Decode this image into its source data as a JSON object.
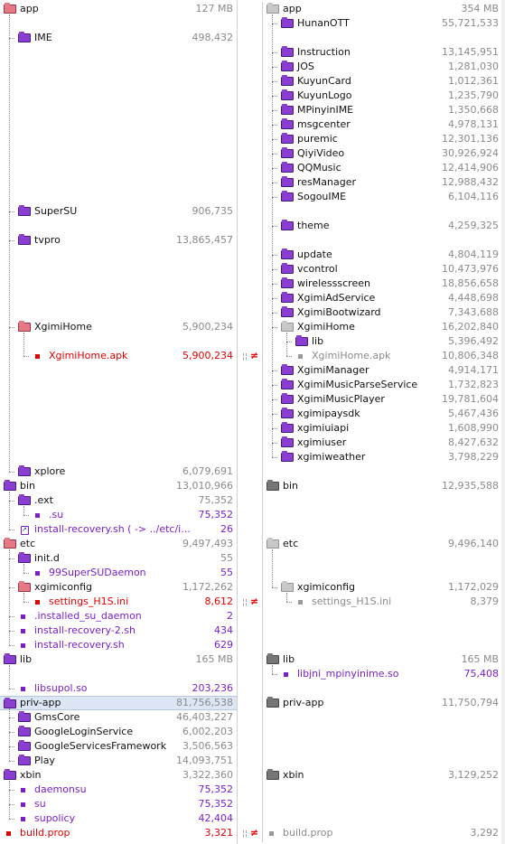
{
  "left": {
    "rows": [
      {
        "row": 0,
        "level": 0,
        "kind": "folder",
        "icon": "folder-open-red",
        "name": "app",
        "name_color": "black",
        "size": "127 MB",
        "size_color": "grey"
      },
      {
        "row": 2,
        "level": 1,
        "kind": "folder",
        "icon": "folder-purple",
        "name": "IME",
        "name_color": "black",
        "size": "498,432",
        "size_color": "grey"
      },
      {
        "row": 14,
        "level": 1,
        "kind": "folder",
        "icon": "folder-purple",
        "name": "SuperSU",
        "name_color": "black",
        "size": "906,735",
        "size_color": "grey"
      },
      {
        "row": 16,
        "level": 1,
        "kind": "folder",
        "icon": "folder-purple",
        "name": "tvpro",
        "name_color": "black",
        "size": "13,865,457",
        "size_color": "grey"
      },
      {
        "row": 22,
        "level": 1,
        "kind": "folder",
        "icon": "folder-open-red",
        "name": "XgimiHome",
        "name_color": "black",
        "size": "5,900,234",
        "size_color": "grey"
      },
      {
        "row": 24,
        "level": 2,
        "kind": "file",
        "icon": "file-red",
        "name": "XgimiHome.apk",
        "name_color": "red",
        "size": "5,900,234",
        "size_color": "red"
      },
      {
        "row": 32,
        "level": 1,
        "kind": "folder",
        "icon": "folder-purple",
        "name": "xplore",
        "name_color": "black",
        "size": "6,079,691",
        "size_color": "grey"
      },
      {
        "row": 33,
        "level": 0,
        "kind": "folder",
        "icon": "folder-purple",
        "name": "bin",
        "name_color": "black",
        "size": "13,010,966",
        "size_color": "grey"
      },
      {
        "row": 34,
        "level": 1,
        "kind": "folder",
        "icon": "folder-purple",
        "name": ".ext",
        "name_color": "black",
        "size": "75,352",
        "size_color": "grey"
      },
      {
        "row": 35,
        "level": 2,
        "kind": "file",
        "icon": "file-purple",
        "name": ".su",
        "name_color": "purple",
        "size": "75,352",
        "size_color": "purple"
      },
      {
        "row": 36,
        "level": 1,
        "kind": "link",
        "icon": "link-icon",
        "name": "install-recovery.sh ( -> ../etc/i...",
        "name_color": "purple",
        "size": "26",
        "size_color": "purple"
      },
      {
        "row": 37,
        "level": 0,
        "kind": "folder",
        "icon": "folder-open-red",
        "name": "etc",
        "name_color": "black",
        "size": "9,497,493",
        "size_color": "grey"
      },
      {
        "row": 38,
        "level": 1,
        "kind": "folder",
        "icon": "folder-purple",
        "name": "init.d",
        "name_color": "black",
        "size": "55",
        "size_color": "grey"
      },
      {
        "row": 39,
        "level": 2,
        "kind": "file",
        "icon": "file-purple",
        "name": "99SuperSUDaemon",
        "name_color": "purple",
        "size": "55",
        "size_color": "purple"
      },
      {
        "row": 40,
        "level": 1,
        "kind": "folder",
        "icon": "folder-open-red",
        "name": "xgimiconfig",
        "name_color": "black",
        "size": "1,172,262",
        "size_color": "grey"
      },
      {
        "row": 41,
        "level": 2,
        "kind": "file",
        "icon": "file-red",
        "name": "settings_H1S.ini",
        "name_color": "red",
        "size": "8,612",
        "size_color": "red"
      },
      {
        "row": 42,
        "level": 1,
        "kind": "file",
        "icon": "file-purple",
        "name": ".installed_su_daemon",
        "name_color": "purple",
        "size": "2",
        "size_color": "purple"
      },
      {
        "row": 43,
        "level": 1,
        "kind": "file",
        "icon": "file-purple",
        "name": "install-recovery-2.sh",
        "name_color": "purple",
        "size": "434",
        "size_color": "purple"
      },
      {
        "row": 44,
        "level": 1,
        "kind": "file",
        "icon": "file-purple",
        "name": "install-recovery.sh",
        "name_color": "purple",
        "size": "629",
        "size_color": "purple"
      },
      {
        "row": 45,
        "level": 0,
        "kind": "folder",
        "icon": "folder-purple",
        "name": "lib",
        "name_color": "black",
        "size": "165 MB",
        "size_color": "grey"
      },
      {
        "row": 47,
        "level": 1,
        "kind": "file",
        "icon": "file-purple",
        "name": "libsupol.so",
        "name_color": "purple",
        "size": "203,236",
        "size_color": "purple"
      },
      {
        "row": 48,
        "level": 0,
        "kind": "folder",
        "icon": "folder-purple",
        "name": "priv-app",
        "name_color": "black",
        "size": "81,756,538",
        "size_color": "grey",
        "selected": true
      },
      {
        "row": 49,
        "level": 1,
        "kind": "folder",
        "icon": "folder-purple",
        "name": "GmsCore",
        "name_color": "black",
        "size": "46,403,227",
        "size_color": "grey"
      },
      {
        "row": 50,
        "level": 1,
        "kind": "folder",
        "icon": "folder-purple",
        "name": "GoogleLoginService",
        "name_color": "black",
        "size": "6,002,203",
        "size_color": "grey"
      },
      {
        "row": 51,
        "level": 1,
        "kind": "folder",
        "icon": "folder-purple",
        "name": "GoogleServicesFramework",
        "name_color": "black",
        "size": "3,506,563",
        "size_color": "grey"
      },
      {
        "row": 52,
        "level": 1,
        "kind": "folder",
        "icon": "folder-purple",
        "name": "Play",
        "name_color": "black",
        "size": "14,093,751",
        "size_color": "grey"
      },
      {
        "row": 53,
        "level": 0,
        "kind": "folder",
        "icon": "folder-purple",
        "name": "xbin",
        "name_color": "black",
        "size": "3,322,360",
        "size_color": "grey"
      },
      {
        "row": 54,
        "level": 1,
        "kind": "file",
        "icon": "file-purple",
        "name": "daemonsu",
        "name_color": "purple",
        "size": "75,352",
        "size_color": "purple"
      },
      {
        "row": 55,
        "level": 1,
        "kind": "file",
        "icon": "file-purple",
        "name": "su",
        "name_color": "purple",
        "size": "75,352",
        "size_color": "purple"
      },
      {
        "row": 56,
        "level": 1,
        "kind": "file",
        "icon": "file-purple",
        "name": "supolicy",
        "name_color": "purple",
        "size": "42,404",
        "size_color": "purple"
      },
      {
        "row": 57,
        "level": 0,
        "kind": "file",
        "icon": "file-red",
        "name": "build.prop",
        "name_color": "red",
        "size": "3,321",
        "size_color": "red",
        "root_file": true
      }
    ]
  },
  "right": {
    "rows": [
      {
        "row": 0,
        "level": 0,
        "kind": "folder",
        "icon": "folder-open-grey",
        "name": "app",
        "name_color": "black",
        "size": "354 MB",
        "size_color": "grey"
      },
      {
        "row": 1,
        "level": 1,
        "kind": "folder",
        "icon": "folder-purple",
        "name": "HunanOTT",
        "name_color": "black",
        "size": "55,721,533",
        "size_color": "grey"
      },
      {
        "row": 3,
        "level": 1,
        "kind": "folder",
        "icon": "folder-purple",
        "name": "Instruction",
        "name_color": "black",
        "size": "13,145,951",
        "size_color": "grey"
      },
      {
        "row": 4,
        "level": 1,
        "kind": "folder",
        "icon": "folder-purple",
        "name": "JOS",
        "name_color": "black",
        "size": "1,281,030",
        "size_color": "grey"
      },
      {
        "row": 5,
        "level": 1,
        "kind": "folder",
        "icon": "folder-purple",
        "name": "KuyunCard",
        "name_color": "black",
        "size": "1,012,361",
        "size_color": "grey"
      },
      {
        "row": 6,
        "level": 1,
        "kind": "folder",
        "icon": "folder-purple",
        "name": "KuyunLogo",
        "name_color": "black",
        "size": "1,235,790",
        "size_color": "grey"
      },
      {
        "row": 7,
        "level": 1,
        "kind": "folder",
        "icon": "folder-purple",
        "name": "MPinyinIME",
        "name_color": "black",
        "size": "1,350,668",
        "size_color": "grey"
      },
      {
        "row": 8,
        "level": 1,
        "kind": "folder",
        "icon": "folder-purple",
        "name": "msgcenter",
        "name_color": "black",
        "size": "4,978,131",
        "size_color": "grey"
      },
      {
        "row": 9,
        "level": 1,
        "kind": "folder",
        "icon": "folder-purple",
        "name": "puremic",
        "name_color": "black",
        "size": "12,301,136",
        "size_color": "grey"
      },
      {
        "row": 10,
        "level": 1,
        "kind": "folder",
        "icon": "folder-purple",
        "name": "QiyiVideo",
        "name_color": "black",
        "size": "30,926,924",
        "size_color": "grey"
      },
      {
        "row": 11,
        "level": 1,
        "kind": "folder",
        "icon": "folder-purple",
        "name": "QQMusic",
        "name_color": "black",
        "size": "12,414,906",
        "size_color": "grey"
      },
      {
        "row": 12,
        "level": 1,
        "kind": "folder",
        "icon": "folder-purple",
        "name": "resManager",
        "name_color": "black",
        "size": "12,988,432",
        "size_color": "grey"
      },
      {
        "row": 13,
        "level": 1,
        "kind": "folder",
        "icon": "folder-purple",
        "name": "SogouIME",
        "name_color": "black",
        "size": "6,104,116",
        "size_color": "grey"
      },
      {
        "row": 15,
        "level": 1,
        "kind": "folder",
        "icon": "folder-purple",
        "name": "theme",
        "name_color": "black",
        "size": "4,259,325",
        "size_color": "grey"
      },
      {
        "row": 17,
        "level": 1,
        "kind": "folder",
        "icon": "folder-purple",
        "name": "update",
        "name_color": "black",
        "size": "4,804,119",
        "size_color": "grey"
      },
      {
        "row": 18,
        "level": 1,
        "kind": "folder",
        "icon": "folder-purple",
        "name": "vcontrol",
        "name_color": "black",
        "size": "10,473,976",
        "size_color": "grey"
      },
      {
        "row": 19,
        "level": 1,
        "kind": "folder",
        "icon": "folder-purple",
        "name": "wirelessscreen",
        "name_color": "black",
        "size": "18,856,658",
        "size_color": "grey"
      },
      {
        "row": 20,
        "level": 1,
        "kind": "folder",
        "icon": "folder-purple",
        "name": "XgimiAdService",
        "name_color": "black",
        "size": "4,448,698",
        "size_color": "grey"
      },
      {
        "row": 21,
        "level": 1,
        "kind": "folder",
        "icon": "folder-purple",
        "name": "XgimiBootwizard",
        "name_color": "black",
        "size": "7,343,688",
        "size_color": "grey"
      },
      {
        "row": 22,
        "level": 1,
        "kind": "folder",
        "icon": "folder-open-grey",
        "name": "XgimiHome",
        "name_color": "black",
        "size": "16,202,840",
        "size_color": "grey"
      },
      {
        "row": 23,
        "level": 2,
        "kind": "folder",
        "icon": "folder-purple",
        "name": "lib",
        "name_color": "black",
        "size": "5,396,492",
        "size_color": "grey"
      },
      {
        "row": 24,
        "level": 2,
        "kind": "file",
        "icon": "file-grey",
        "name": "XgimiHome.apk",
        "name_color": "grey",
        "size": "10,806,348",
        "size_color": "grey"
      },
      {
        "row": 25,
        "level": 1,
        "kind": "folder",
        "icon": "folder-purple",
        "name": "XgimiManager",
        "name_color": "black",
        "size": "4,914,171",
        "size_color": "grey"
      },
      {
        "row": 26,
        "level": 1,
        "kind": "folder",
        "icon": "folder-purple",
        "name": "XgimiMusicParseService",
        "name_color": "black",
        "size": "1,732,823",
        "size_color": "grey"
      },
      {
        "row": 27,
        "level": 1,
        "kind": "folder",
        "icon": "folder-purple",
        "name": "XgimiMusicPlayer",
        "name_color": "black",
        "size": "19,781,604",
        "size_color": "grey"
      },
      {
        "row": 28,
        "level": 1,
        "kind": "folder",
        "icon": "folder-purple",
        "name": "xgimipaysdk",
        "name_color": "black",
        "size": "5,467,436",
        "size_color": "grey"
      },
      {
        "row": 29,
        "level": 1,
        "kind": "folder",
        "icon": "folder-purple",
        "name": "xgimiuiapi",
        "name_color": "black",
        "size": "1,608,990",
        "size_color": "grey"
      },
      {
        "row": 30,
        "level": 1,
        "kind": "folder",
        "icon": "folder-purple",
        "name": "xgimiuser",
        "name_color": "black",
        "size": "8,427,632",
        "size_color": "grey"
      },
      {
        "row": 31,
        "level": 1,
        "kind": "folder",
        "icon": "folder-purple",
        "name": "xgimiweather",
        "name_color": "black",
        "size": "3,798,229",
        "size_color": "grey"
      },
      {
        "row": 33,
        "level": 0,
        "kind": "folder",
        "icon": "folder-grey",
        "name": "bin",
        "name_color": "black",
        "size": "12,935,588",
        "size_color": "grey"
      },
      {
        "row": 37,
        "level": 0,
        "kind": "folder",
        "icon": "folder-open-grey",
        "name": "etc",
        "name_color": "black",
        "size": "9,496,140",
        "size_color": "grey"
      },
      {
        "row": 40,
        "level": 1,
        "kind": "folder",
        "icon": "folder-open-grey",
        "name": "xgimiconfig",
        "name_color": "black",
        "size": "1,172,029",
        "size_color": "grey"
      },
      {
        "row": 41,
        "level": 2,
        "kind": "file",
        "icon": "file-grey",
        "name": "settings_H1S.ini",
        "name_color": "grey",
        "size": "8,379",
        "size_color": "grey"
      },
      {
        "row": 45,
        "level": 0,
        "kind": "folder",
        "icon": "folder-grey",
        "name": "lib",
        "name_color": "black",
        "size": "165 MB",
        "size_color": "grey"
      },
      {
        "row": 46,
        "level": 1,
        "kind": "file",
        "icon": "file-purple",
        "name": "libjni_mpinyinime.so",
        "name_color": "purple",
        "size": "75,408",
        "size_color": "purple"
      },
      {
        "row": 48,
        "level": 0,
        "kind": "folder",
        "icon": "folder-grey",
        "name": "priv-app",
        "name_color": "black",
        "size": "11,750,794",
        "size_color": "grey"
      },
      {
        "row": 53,
        "level": 0,
        "kind": "folder",
        "icon": "folder-grey",
        "name": "xbin",
        "name_color": "black",
        "size": "3,129,252",
        "size_color": "grey"
      },
      {
        "row": 57,
        "level": 0,
        "kind": "file",
        "icon": "file-grey",
        "name": "build.prop",
        "name_color": "grey",
        "size": "3,292",
        "size_color": "grey",
        "root_file": true
      }
    ]
  },
  "diff_markers": [
    {
      "row": 24,
      "symbol": "≠"
    },
    {
      "row": 41,
      "symbol": "≠"
    },
    {
      "row": 57,
      "symbol": "≠"
    }
  ],
  "colors": {
    "purple": "#7a1fc9",
    "red": "#e00000",
    "grey": "#8a8a8a",
    "selection": "#dce6f4"
  }
}
